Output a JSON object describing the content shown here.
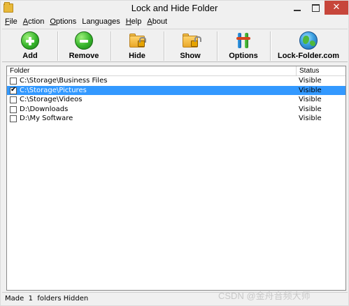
{
  "window": {
    "title": "Lock and Hide Folder",
    "close_glyph": "✕"
  },
  "menu": {
    "items": [
      {
        "label": "File",
        "accel": "F",
        "rest": "ile"
      },
      {
        "label": "Action",
        "accel": "A",
        "rest": "ction"
      },
      {
        "label": "Options",
        "accel": "O",
        "rest": "ptions"
      },
      {
        "label": "Languages",
        "accel": "",
        "rest": "Languages"
      },
      {
        "label": "Help",
        "accel": "H",
        "rest": "elp"
      },
      {
        "label": "About",
        "accel": "A",
        "rest": "bout"
      }
    ]
  },
  "toolbar": {
    "add_label": "Add",
    "remove_label": "Remove",
    "hide_label": "Hide",
    "show_label": "Show",
    "options_label": "Options",
    "website_label": "Lock-Folder.com"
  },
  "list": {
    "columns": {
      "folder": "Folder",
      "status": "Status"
    },
    "rows": [
      {
        "path": "C:\\Storage\\Business Files",
        "status": "Visible",
        "checked": false,
        "selected": false
      },
      {
        "path": "C:\\Storage\\Pictures",
        "status": "Visible",
        "checked": true,
        "selected": true
      },
      {
        "path": "C:\\Storage\\Videos",
        "status": "Visible",
        "checked": false,
        "selected": false
      },
      {
        "path": "D:\\Downloads",
        "status": "Visible",
        "checked": false,
        "selected": false
      },
      {
        "path": "D:\\My Software",
        "status": "Visible",
        "checked": false,
        "selected": false
      }
    ],
    "check_glyph": "✔"
  },
  "statusbar": {
    "text": "Made  1  folders Hidden"
  },
  "watermark": "CSDN @金舟音频大师",
  "colors": {
    "selection": "#3399ff",
    "close_button": "#c7463b",
    "window_bg": "#f0f0f0"
  },
  "icons": {
    "add": "plus-circle-icon",
    "remove": "minus-circle-icon",
    "hide": "locked-folder-icon",
    "show": "unlocked-folder-icon",
    "options": "tools-icon",
    "website": "globe-icon"
  }
}
